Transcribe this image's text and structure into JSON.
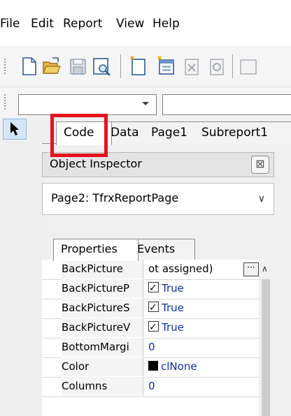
{
  "menu": [
    "File",
    "Edit",
    "Report",
    "View",
    "Help"
  ],
  "toolbar_icons": [
    "new-page-icon",
    "open-folder-icon",
    "save-icon",
    "preview-icon",
    "new-report-page-icon",
    "new-dialog-icon",
    "delete-page-icon",
    "page-settings-icon"
  ],
  "tabs": [
    "Code",
    "Data",
    "Page1",
    "Subreport1"
  ],
  "inspector": {
    "title": "Object Inspector",
    "close_glyph": "⊠",
    "selected_object": "Page2: TfrxReportPage",
    "select_arrow": "∨",
    "subtabs": [
      "Properties",
      "Events"
    ],
    "properties": [
      {
        "name": "BackPicture",
        "value": "ot assigned)",
        "ellipsis": "···"
      },
      {
        "name": "BackPictureP",
        "value": "True",
        "checkbox": true
      },
      {
        "name": "BackPictureS",
        "value": "True",
        "checkbox": true
      },
      {
        "name": "BackPictureV",
        "value": "True",
        "checkbox": true
      },
      {
        "name": "BottomMargi",
        "value": "0"
      },
      {
        "name": "Color",
        "value": "clNone",
        "swatch": true
      },
      {
        "name": "Columns",
        "value": "0"
      }
    ],
    "scroll_up": "∧"
  },
  "colors": {
    "highlight": "#e5121b",
    "value_text": "#0a2fa8"
  }
}
